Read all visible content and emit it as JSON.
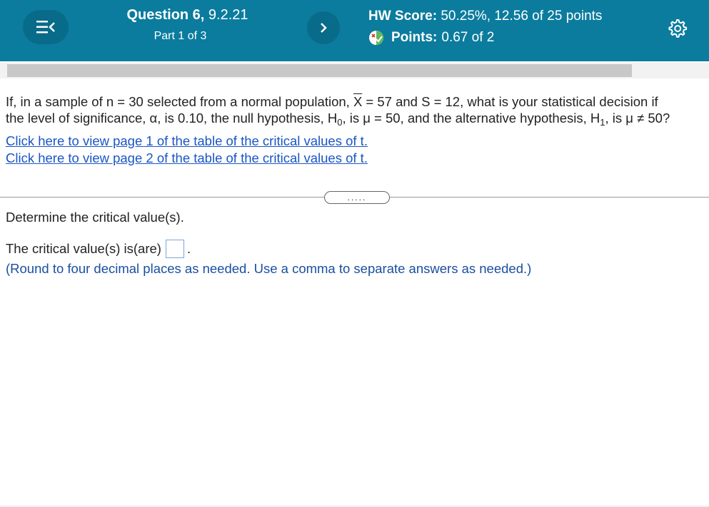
{
  "header": {
    "question_label": "Question 6,",
    "question_number": "9.2.21",
    "part": "Part 1 of 3",
    "hw_score_label": "HW Score:",
    "hw_score_value": "50.25%, 12.56 of 25 points",
    "points_label": "Points:",
    "points_value": "0.67 of 2",
    "icons": [
      "menu-collapse-icon",
      "chevron-right-icon",
      "partial-points-icon",
      "gear-icon"
    ],
    "colors": {
      "bar": "#0b7c9e",
      "button": "#086b89"
    }
  },
  "question": {
    "line1_a": "If, in a sample of n = 30 selected from a normal population, ",
    "xbar": "X",
    "line1_b": " = 57 and S = 12, what is your statistical decision if",
    "line2_a": "the level of significance, α, is 0.10, the null hypothesis, H",
    "h0_sub": "0",
    "line2_b": ", is μ = 50, and the alternative hypothesis, H",
    "h1_sub": "1",
    "line2_c": ", is μ ≠ 50?",
    "link1": "Click here to view page 1 of the table of the critical values of t.",
    "link2": "Click here to view page 2 of the table of the critical values of t."
  },
  "more_button": ".....",
  "part1": {
    "prompt": "Determine the critical value(s).",
    "answer_label": "The critical value(s) is(are)",
    "answer_value": "",
    "answer_suffix": ".",
    "hint": "(Round to four decimal places as needed. Use a comma to separate answers as needed.)"
  }
}
